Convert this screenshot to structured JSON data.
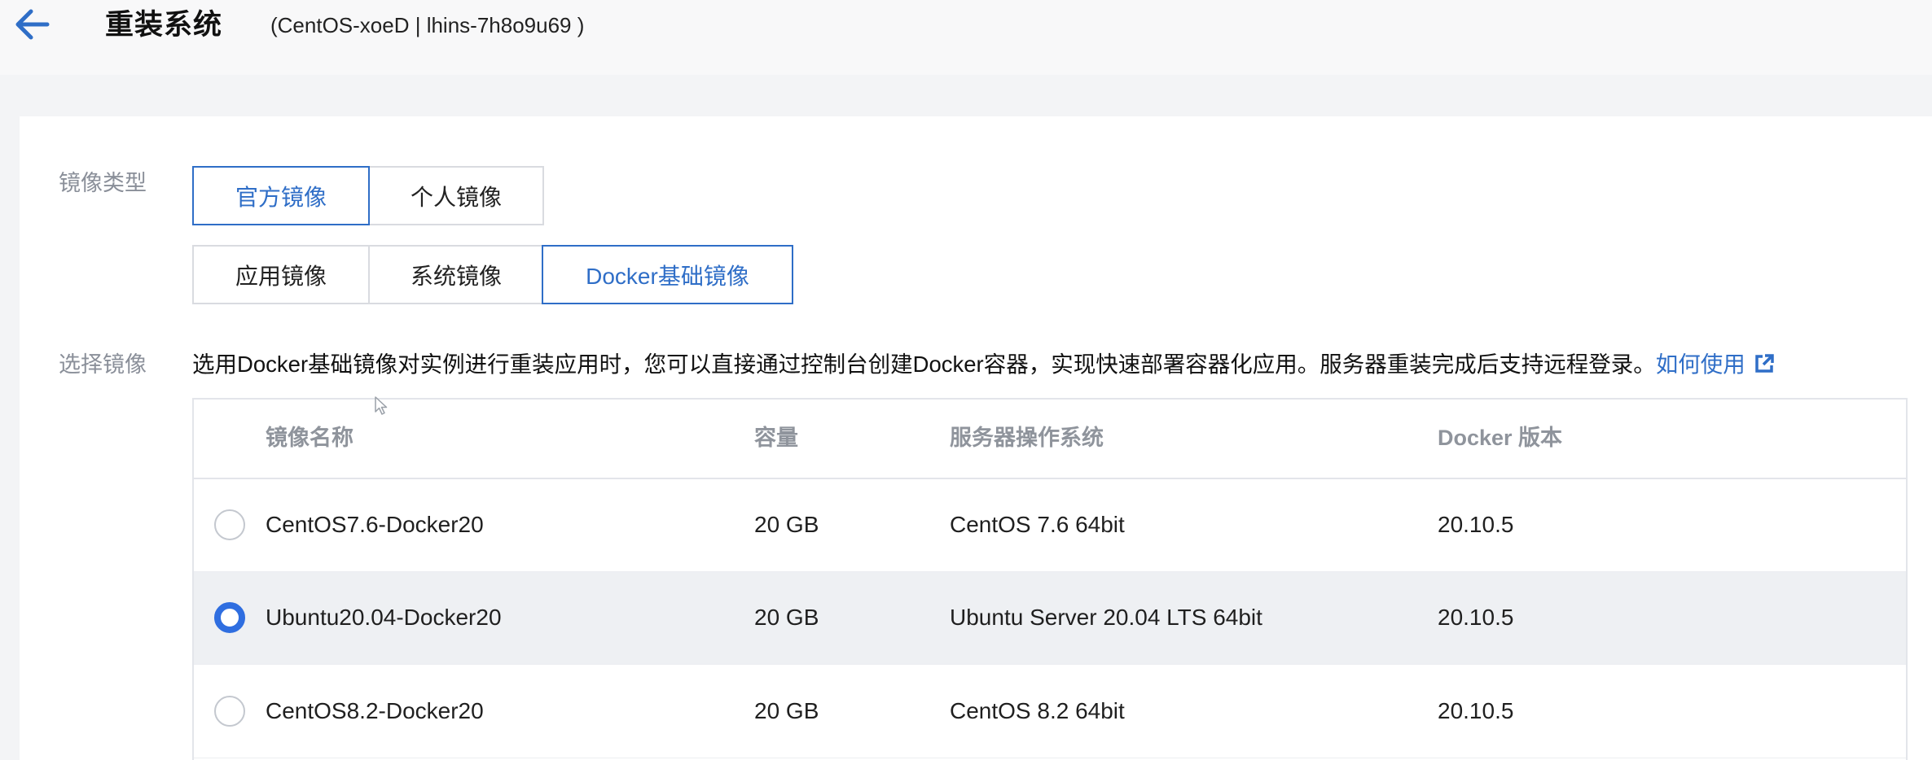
{
  "header": {
    "title": "重装系统",
    "instance_info": "(CentOS-xoeD | lhins-7h8o9u69 )"
  },
  "image_type": {
    "label": "镜像类型",
    "tabs": [
      "官方镜像",
      "个人镜像"
    ],
    "active_tab": "官方镜像",
    "sub_tabs": [
      "应用镜像",
      "系统镜像",
      "Docker基础镜像"
    ],
    "active_sub_tab": "Docker基础镜像"
  },
  "select_image": {
    "label": "选择镜像",
    "description": "选用Docker基础镜像对实例进行重装应用时，您可以直接通过控制台创建Docker容器，实现快速部署容器化应用。服务器重装完成后支持远程登录。",
    "link_text": "如何使用"
  },
  "table": {
    "columns": [
      "镜像名称",
      "容量",
      "服务器操作系统",
      "Docker 版本"
    ],
    "rows": [
      {
        "name": "CentOS7.6-Docker20",
        "capacity": "20 GB",
        "os": "CentOS 7.6 64bit",
        "docker_version": "20.10.5",
        "selected": false
      },
      {
        "name": "Ubuntu20.04-Docker20",
        "capacity": "20 GB",
        "os": "Ubuntu Server 20.04 LTS 64bit",
        "docker_version": "20.10.5",
        "selected": true
      },
      {
        "name": "CentOS8.2-Docker20",
        "capacity": "20 GB",
        "os": "CentOS 8.2 64bit",
        "docker_version": "20.10.5",
        "selected": false
      }
    ]
  },
  "colors": {
    "accent": "#2f6ec7",
    "radio_checked": "#2f6ee0",
    "selected_row_bg": "#eef0f3",
    "label_gray": "#8a8f99"
  },
  "icons": {
    "back": "arrow-left-icon",
    "external_link": "external-link-icon"
  }
}
